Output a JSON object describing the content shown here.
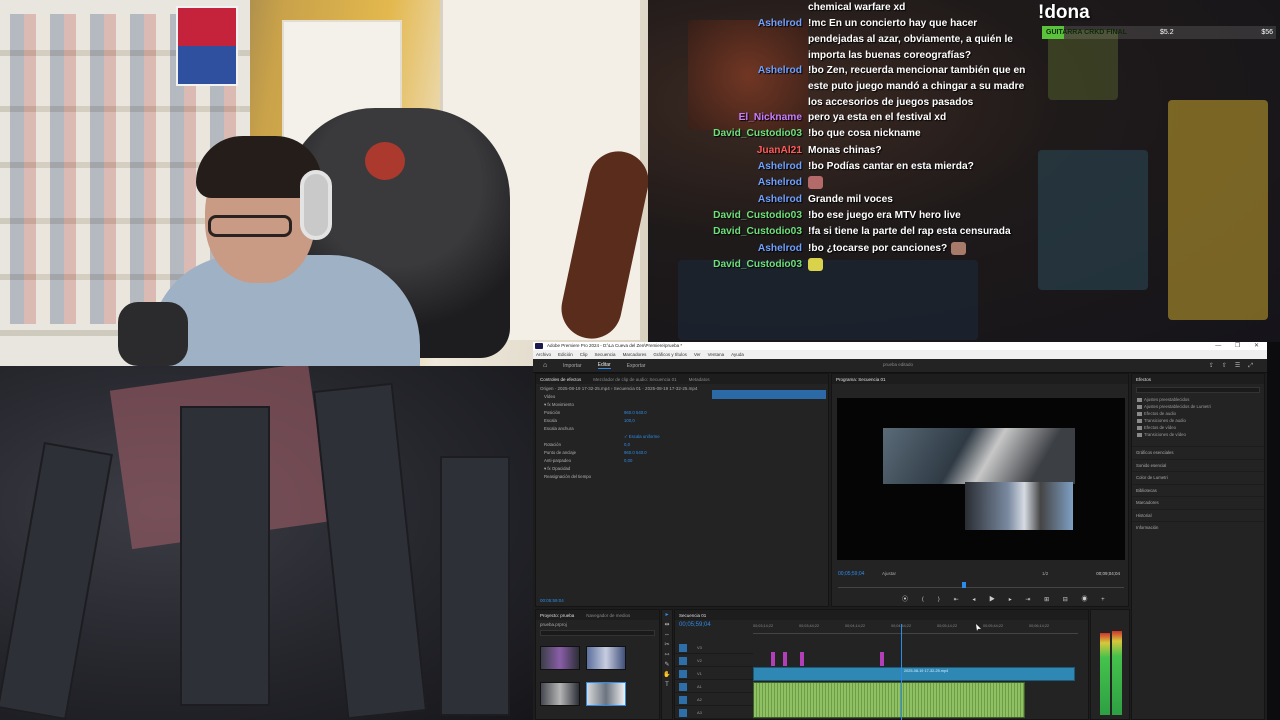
{
  "chat": {
    "messages": [
      {
        "user": "",
        "user_color": "#ffffff",
        "text": "chemical warfare xd"
      },
      {
        "user": "Ashelrod",
        "user_color": "#6ea0ff",
        "text": "!mc En un concierto hay que hacer pendejadas al azar, obviamente, a quién le importa las buenas coreografías?"
      },
      {
        "user": "Ashelrod",
        "user_color": "#6ea0ff",
        "text": "!bo Zen, recuerda mencionar también que en este puto juego mandó a chingar a su madre los accesorios de juegos pasados"
      },
      {
        "user": "El_Nickname",
        "user_color": "#c77dff",
        "text": "pero ya esta en el festival xd"
      },
      {
        "user": "David_Custodio03",
        "user_color": "#6ee07a",
        "text": "!bo que cosa nickname"
      },
      {
        "user": "JuanAl21",
        "user_color": "#ff5a5a",
        "text": "Monas chinas?"
      },
      {
        "user": "Ashelrod",
        "user_color": "#6ea0ff",
        "text": "!bo Podías cantar en esta mierda?"
      },
      {
        "user": "Ashelrod",
        "user_color": "#6ea0ff",
        "text": "",
        "emote": "emote-face-icon",
        "emote_color": "#b56a6a"
      },
      {
        "user": "Ashelrod",
        "user_color": "#6ea0ff",
        "text": "Grande mil voces"
      },
      {
        "user": "David_Custodio03",
        "user_color": "#6ee07a",
        "text": "!bo ese juego era MTV hero live"
      },
      {
        "user": "David_Custodio03",
        "user_color": "#6ee07a",
        "text": "!fa si tiene la parte del rap esta censurada"
      },
      {
        "user": "Ashelrod",
        "user_color": "#6ea0ff",
        "text": "!bo ¿tocarse por canciones?",
        "emote": "emote-face-icon",
        "emote_color": "#a87a6a"
      },
      {
        "user": "David_Custodio03",
        "user_color": "#6ee07a",
        "text": "",
        "emote": "emote-cat-icon",
        "emote_color": "#d9d24a"
      }
    ]
  },
  "donation": {
    "title": "!dona",
    "goal_name": "GUITARRA CRKD FINAL",
    "current": "$5.2",
    "goal": "$56",
    "progress": 0.093
  },
  "premiere": {
    "window_title": "Adobe Premiere Pro 2024 - D:\\La Cueva del Zen\\Premiere\\prueba *",
    "window_controls": "—  ❐  ✕",
    "menu": [
      "Archivo",
      "Edición",
      "Clip",
      "Secuencia",
      "Marcadores",
      "Gráficos y títulos",
      "Ver",
      "Ventana",
      "Ayuda"
    ],
    "workspaces": [
      "Importar",
      "Editar",
      "Exportar"
    ],
    "active_workspace": "Editar",
    "header_center": "prueba  editado",
    "source_tabs": [
      "Controles de efectos",
      "Mezclador de clip de audio: Secuencia 01",
      "Metadatos"
    ],
    "source_name": "Origen · 2025-08-19 17-32-25.mp4  ›  Secuencia 01 · 2025-08-19 17-32-25.mp4",
    "fx_rows": [
      {
        "label": "Vídeo",
        "value": ""
      },
      {
        "label": "▾ fx Movimiento",
        "value": ""
      },
      {
        "label": "Posición",
        "value": "960.0  540.0"
      },
      {
        "label": "Escala",
        "value": "100,0"
      },
      {
        "label": "Escala anchura",
        "value": ""
      },
      {
        "label": "",
        "value": "✓ Escala uniforme"
      },
      {
        "label": "Rotación",
        "value": "0,0"
      },
      {
        "label": "Punto de anclaje",
        "value": "960.0  540.0"
      },
      {
        "label": "Anti-parpadeo",
        "value": "0,00"
      },
      {
        "label": "▾ fx Opacidad",
        "value": ""
      },
      {
        "label": "Reasignación del tiempo",
        "value": ""
      }
    ],
    "fx_timecode": "00:05:59:04",
    "program_tab": "Programa: Secuencia 01",
    "program_timecode": "00;05;59;04",
    "program_fit": "Ajustar",
    "program_fraction": "1/2",
    "program_duration": "00;09;04;04",
    "transport_icons": "⦿ ⟨ ⟩ ⇤ ◂ ▶ ▸ ⇥ ⊞ ⊟ ◉ +",
    "effects_tab": "Efectos",
    "effects_folders": [
      "Ajustes preestablecidos",
      "Ajustes preestablecidos de Lumetri",
      "Efectos de audio",
      "Transiciones de audio",
      "Efectos de vídeo",
      "Transiciones de vídeo"
    ],
    "effects_sections": [
      "Gráficos esenciales",
      "Sonido esencial",
      "Color de Lumetri",
      "Bibliotecas",
      "Marcadores",
      "Historial",
      "Información"
    ],
    "project_tabs": [
      "Proyecto: prueba",
      "Navegador de medios"
    ],
    "project_name": "prueba.prproj",
    "tools": [
      "▸",
      "⇹",
      "⇔",
      "✂",
      "⇿",
      "✎",
      "✋",
      "T"
    ],
    "timeline_tab": "Secuencia 01",
    "timeline_timecode": "00;05;59;04",
    "ruler_labels": [
      "00;03;14;22",
      "00;03;44;22",
      "00;04;14;22",
      "00;04;44;22",
      "00;05;14;22",
      "00;05;44;22",
      "00;06;14;22"
    ],
    "tracks": [
      "V3",
      "V2",
      "V1",
      "A1",
      "A2",
      "A3"
    ],
    "clip_name": "2025-08-19 17-32-25.mp4",
    "accent": "#2d8ceb"
  }
}
